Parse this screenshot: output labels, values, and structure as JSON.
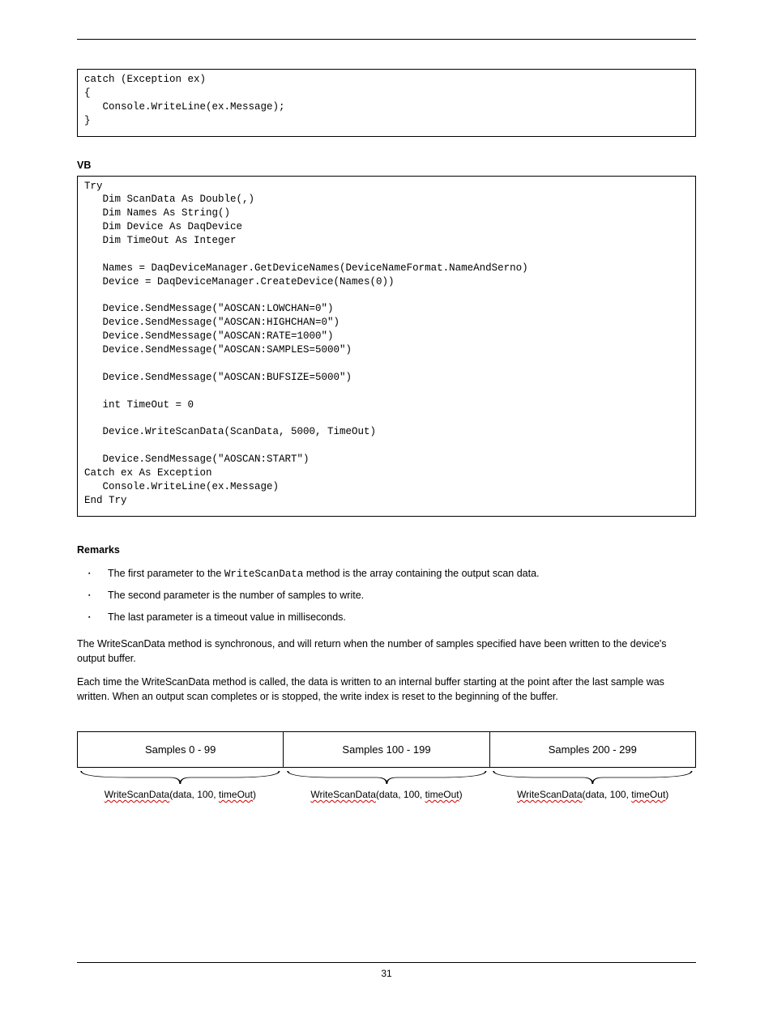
{
  "code_block_1": "catch (Exception ex)\n{\n   Console.WriteLine(ex.Message);\n}",
  "vb_label": "VB",
  "code_block_2": "Try\n   Dim ScanData As Double(,)\n   Dim Names As String()\n   Dim Device As DaqDevice\n   Dim TimeOut As Integer\n\n   Names = DaqDeviceManager.GetDeviceNames(DeviceNameFormat.NameAndSerno)\n   Device = DaqDeviceManager.CreateDevice(Names(0))\n\n   Device.SendMessage(\"AOSCAN:LOWCHAN=0\")\n   Device.SendMessage(\"AOSCAN:HIGHCHAN=0\")\n   Device.SendMessage(\"AOSCAN:RATE=1000\")\n   Device.SendMessage(\"AOSCAN:SAMPLES=5000\")\n\n   Device.SendMessage(\"AOSCAN:BUFSIZE=5000\")\n\n   int TimeOut = 0\n\n   Device.WriteScanData(ScanData, 5000, TimeOut)\n\n   Device.SendMessage(\"AOSCAN:START\")\nCatch ex As Exception\n   Console.WriteLine(ex.Message)\nEnd Try",
  "remarks_label": "Remarks",
  "bullets": {
    "b1_pre": "The first parameter to the ",
    "b1_code": "WriteScanData",
    "b1_post": " method is the array containing the output scan data.",
    "b2": "The second parameter is the number of samples to write.",
    "b3": "The last parameter is a timeout value in milliseconds."
  },
  "para1": "The WriteScanData method is synchronous, and will return when the number of samples specified have been written to the device's output buffer.",
  "para2": "Each time the WriteScanData method is called, the data is written to an internal buffer starting at the point after the last sample was written. When an output scan completes or is stopped, the write index is reset to the beginning of the buffer.",
  "diagram": {
    "box1": "Samples 0 - 99",
    "box2": "Samples 100 - 199",
    "box3": "Samples 200 - 299",
    "cap_method": "WriteScanData",
    "cap_mid_a": "(data, 100, ",
    "cap_timeout": "timeOut",
    "cap_close": ")"
  },
  "page_number": "31"
}
